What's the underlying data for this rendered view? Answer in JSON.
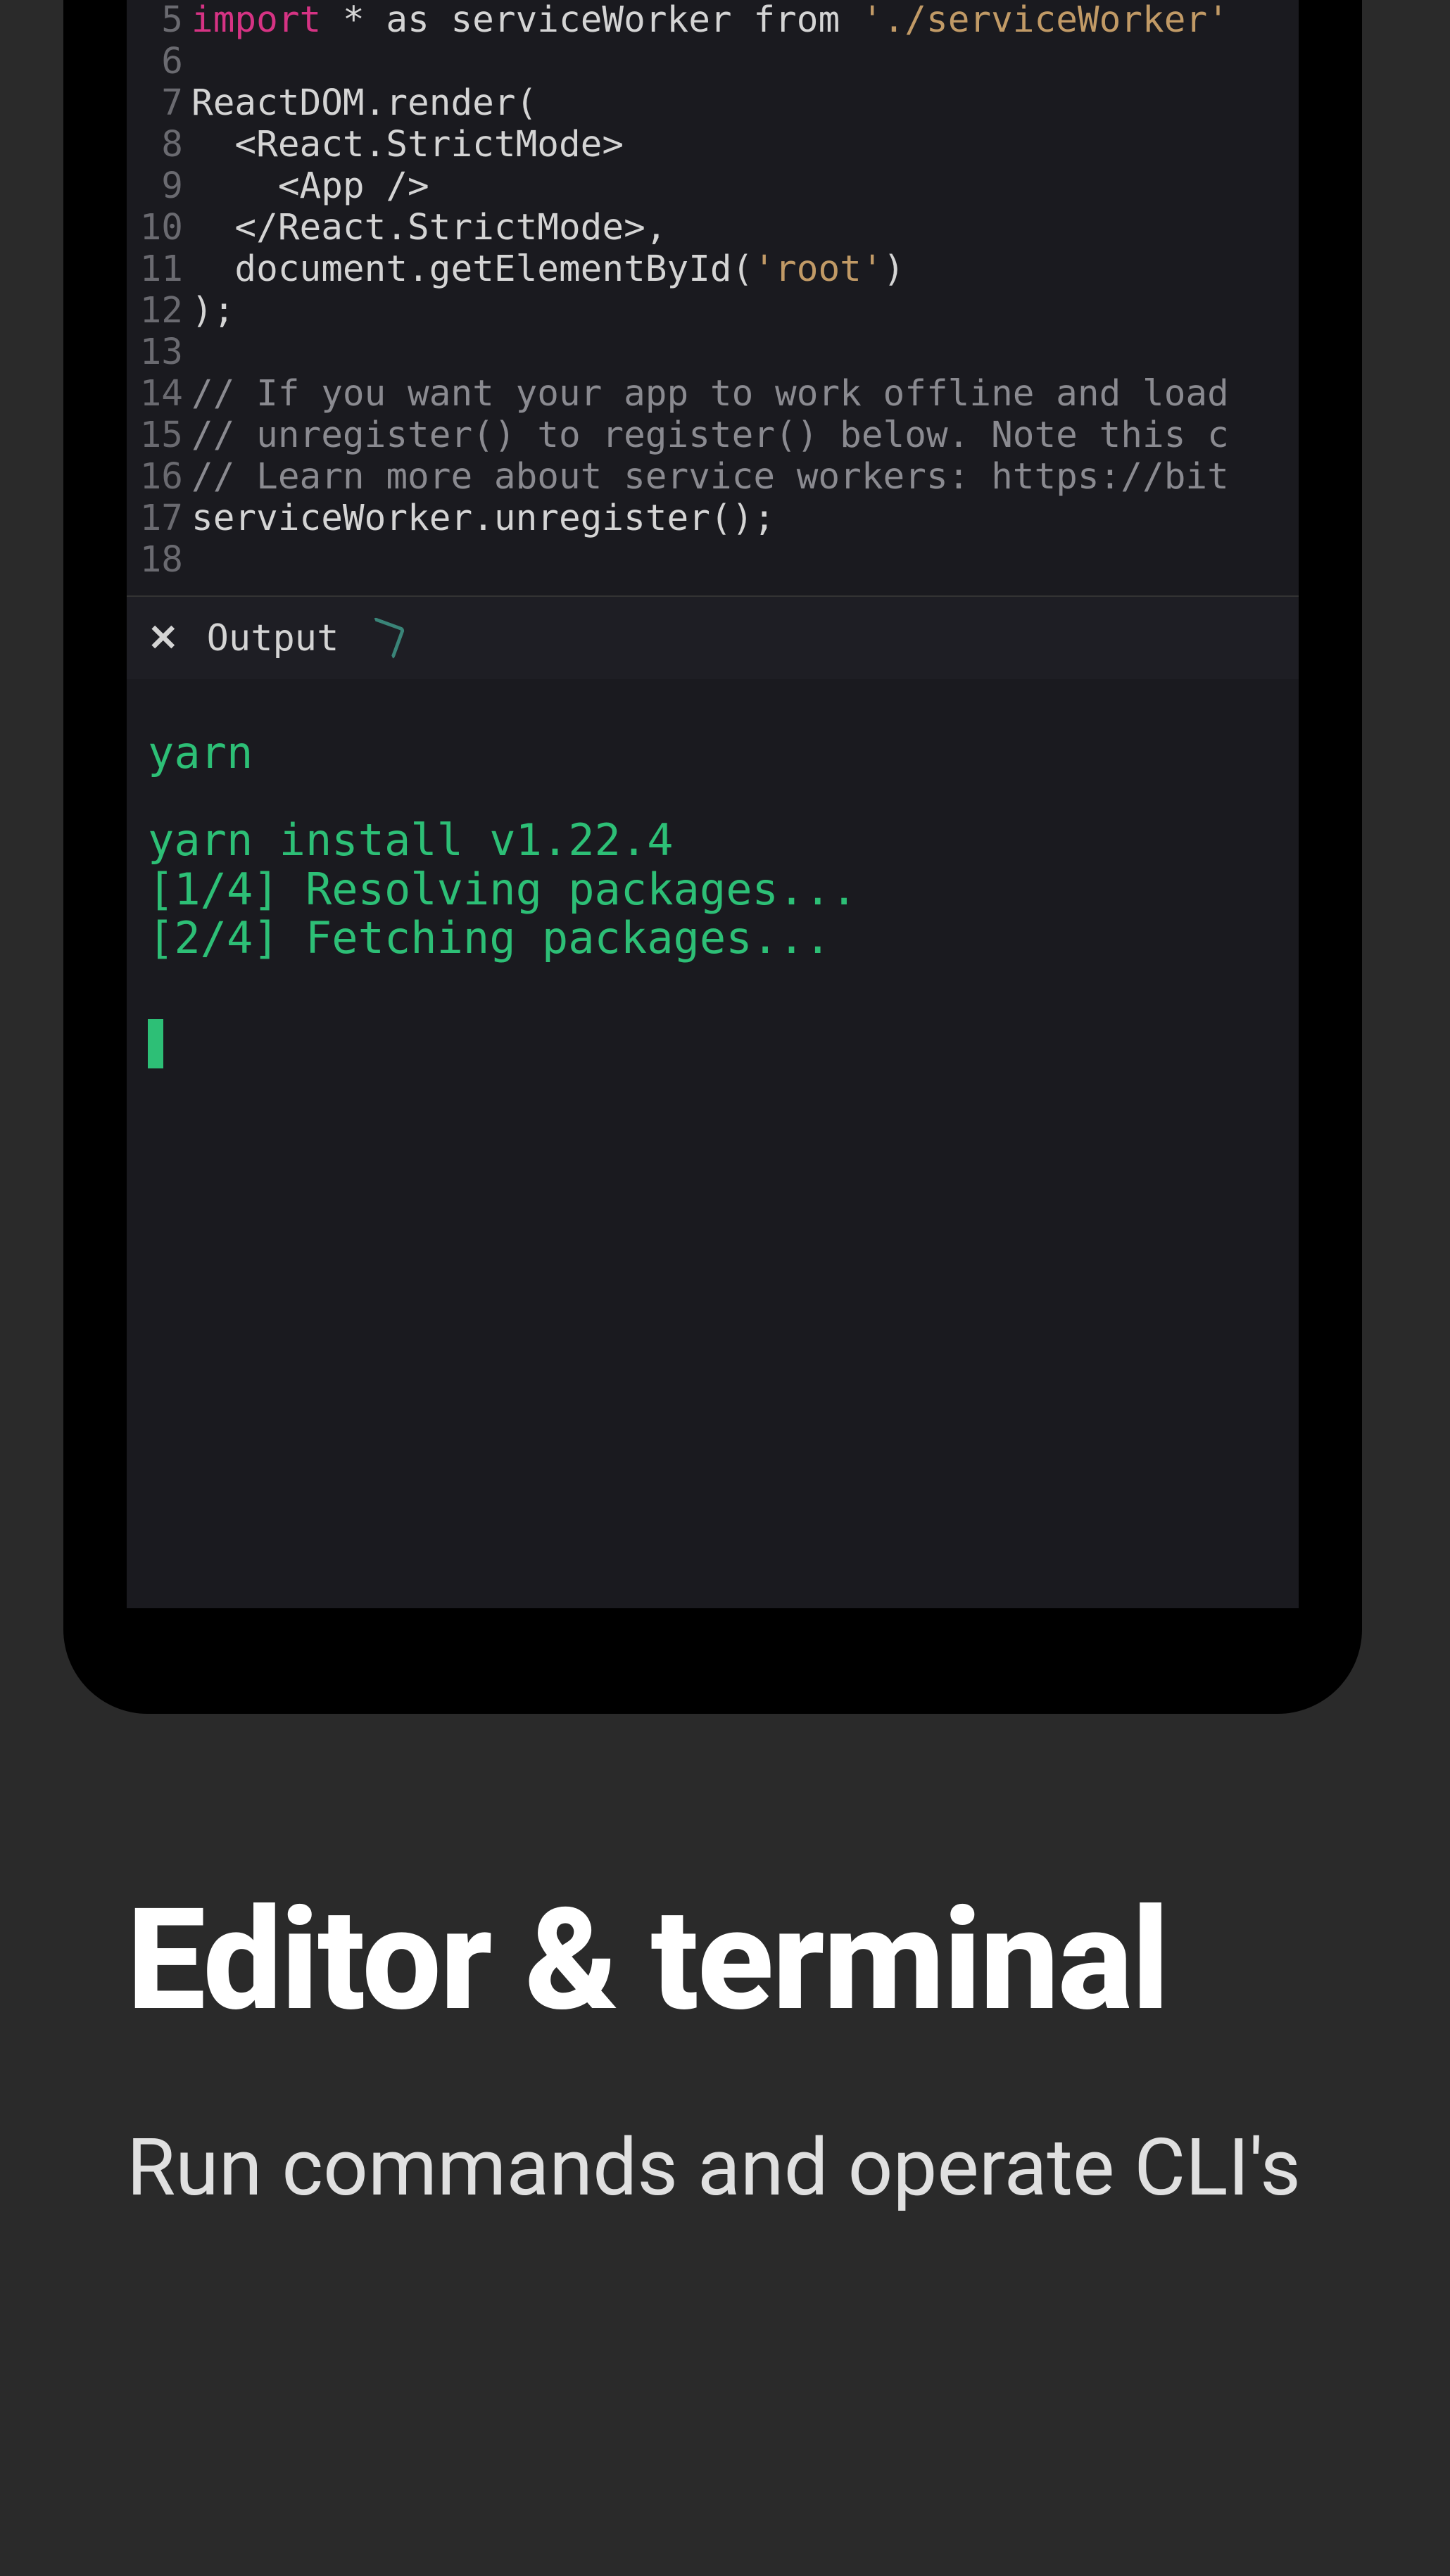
{
  "editor": {
    "lines": [
      {
        "n": 5,
        "tokens": [
          {
            "t": "import ",
            "c": "tok-keyword"
          },
          {
            "t": "* ",
            "c": "tok-star"
          },
          {
            "t": "as serviceWorker from ",
            "c": "tok-default"
          },
          {
            "t": "'./serviceWorker'",
            "c": "tok-string"
          }
        ]
      },
      {
        "n": 6,
        "tokens": []
      },
      {
        "n": 7,
        "tokens": [
          {
            "t": "ReactDOM.render(",
            "c": "tok-default"
          }
        ]
      },
      {
        "n": 8,
        "tokens": [
          {
            "t": "  <React.StrictMode>",
            "c": "tok-tag"
          }
        ]
      },
      {
        "n": 9,
        "tokens": [
          {
            "t": "    <App />",
            "c": "tok-tag"
          }
        ]
      },
      {
        "n": 10,
        "tokens": [
          {
            "t": "  </React.StrictMode>,",
            "c": "tok-tag"
          }
        ]
      },
      {
        "n": 11,
        "tokens": [
          {
            "t": "  document.getElementById(",
            "c": "tok-default"
          },
          {
            "t": "'root'",
            "c": "tok-string"
          },
          {
            "t": ")",
            "c": "tok-default"
          }
        ]
      },
      {
        "n": 12,
        "tokens": [
          {
            "t": ");",
            "c": "tok-default"
          }
        ]
      },
      {
        "n": 13,
        "tokens": []
      },
      {
        "n": 14,
        "tokens": [
          {
            "t": "// If you want your app to work offline and load",
            "c": "tok-comment"
          }
        ]
      },
      {
        "n": 15,
        "tokens": [
          {
            "t": "// unregister() to register() below. Note this c",
            "c": "tok-comment"
          }
        ]
      },
      {
        "n": 16,
        "tokens": [
          {
            "t": "// Learn more about service workers: https://bit",
            "c": "tok-comment"
          }
        ]
      },
      {
        "n": 17,
        "tokens": [
          {
            "t": "serviceWorker.unregister();",
            "c": "tok-default"
          }
        ]
      },
      {
        "n": 18,
        "tokens": []
      }
    ]
  },
  "output_panel": {
    "close_symbol": "✕",
    "label": "Output"
  },
  "terminal": {
    "lines": [
      "yarn",
      "",
      "yarn install v1.22.4",
      "[1/4] Resolving packages...",
      "[2/4] Fetching packages..."
    ]
  },
  "marketing": {
    "headline": "Editor & terminal",
    "subhead": "Run commands and operate CLI's"
  },
  "colors": {
    "terminal_green": "#2dbf76",
    "bg": "#2a2a2a",
    "device": "#000000",
    "screen": "#1a1a1f"
  }
}
